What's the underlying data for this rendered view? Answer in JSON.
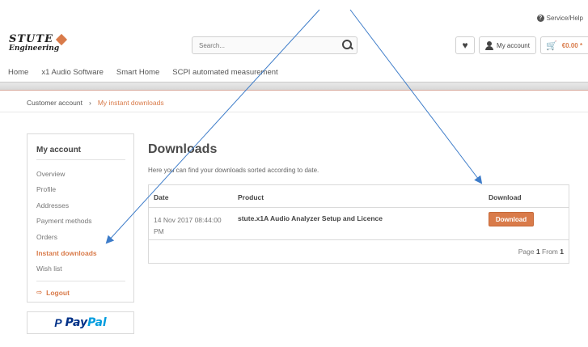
{
  "header": {
    "service_help": "Service/Help",
    "logo_line1": "STUTE",
    "logo_line2": "Engineering",
    "search_placeholder": "Search...",
    "account_label": "My account",
    "cart_total": "€0.00 *"
  },
  "nav": {
    "items": [
      {
        "label": "Home"
      },
      {
        "label": "x1 Audio Software"
      },
      {
        "label": "Smart Home"
      },
      {
        "label": "SCPI automated measurement"
      }
    ]
  },
  "breadcrumb": {
    "parent": "Customer account",
    "separator": "›",
    "current": "My instant downloads"
  },
  "sidebar": {
    "title": "My account",
    "items": [
      {
        "label": "Overview"
      },
      {
        "label": "Profile"
      },
      {
        "label": "Addresses"
      },
      {
        "label": "Payment methods"
      },
      {
        "label": "Orders"
      },
      {
        "label": "Instant downloads"
      },
      {
        "label": "Wish list"
      }
    ],
    "logout": "Logout"
  },
  "paypal": {
    "brand_a": "Pay",
    "brand_b": "Pal"
  },
  "main": {
    "heading": "Downloads",
    "subtitle": "Here you can find your downloads sorted according to date.",
    "table": {
      "headers": {
        "date": "Date",
        "product": "Product",
        "download": "Download"
      },
      "rows": [
        {
          "date": "14 Nov 2017 08:44:00 PM",
          "product": "stute.x1A Audio Analyzer Setup and Licence",
          "button": "Download"
        }
      ],
      "pager": {
        "prefix": "Page",
        "page": "1",
        "mid": "From",
        "total": "1"
      }
    }
  },
  "colors": {
    "accent": "#d97b4a",
    "annotation_arrow": "#3d7cc9"
  }
}
